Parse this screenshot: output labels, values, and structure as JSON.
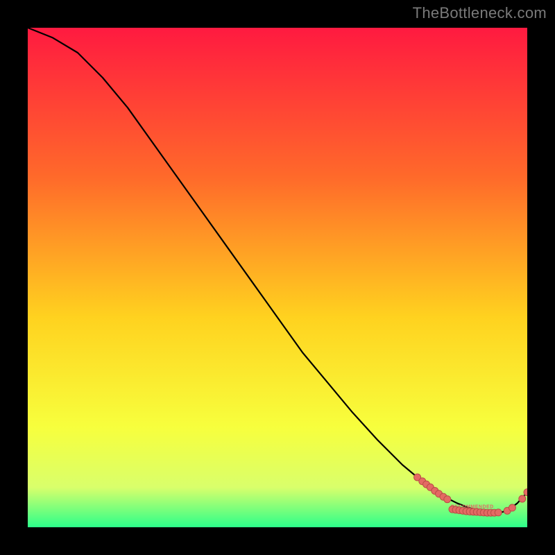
{
  "watermark": "TheBottleneck.com",
  "colors": {
    "page_bg": "#000000",
    "gradient_top": "#ff1a40",
    "gradient_mid_upper": "#ff6a2a",
    "gradient_mid": "#ffd21f",
    "gradient_mid_lower": "#f7ff3d",
    "gradient_near_bottom": "#d9ff6b",
    "gradient_bottom": "#2cff8a",
    "curve": "#000000",
    "marker_fill": "#e46a63",
    "marker_stroke": "#b94d46"
  },
  "chart_data": {
    "type": "line",
    "title": "",
    "xlabel": "",
    "ylabel": "",
    "xlim": [
      0,
      100
    ],
    "ylim": [
      0,
      100
    ],
    "curve": {
      "x": [
        0,
        5,
        10,
        15,
        20,
        25,
        30,
        35,
        40,
        45,
        50,
        55,
        60,
        65,
        70,
        75,
        78,
        80,
        82,
        84,
        86,
        88,
        90,
        92,
        94,
        96,
        98,
        100
      ],
      "y": [
        100,
        98,
        95,
        90,
        84,
        77,
        70,
        63,
        56,
        49,
        42,
        35,
        29,
        23,
        17.5,
        12.5,
        10,
        8.5,
        7,
        5.8,
        4.8,
        4,
        3.4,
        3,
        2.8,
        3.3,
        4.8,
        7
      ]
    },
    "markers": [
      {
        "x": 78.0,
        "y": 10.0
      },
      {
        "x": 79.0,
        "y": 9.2
      },
      {
        "x": 79.8,
        "y": 8.6
      },
      {
        "x": 80.6,
        "y": 8.0
      },
      {
        "x": 81.5,
        "y": 7.3
      },
      {
        "x": 82.3,
        "y": 6.7
      },
      {
        "x": 83.2,
        "y": 6.1
      },
      {
        "x": 84.0,
        "y": 5.6
      },
      {
        "x": 85.0,
        "y": 3.6
      },
      {
        "x": 85.7,
        "y": 3.5
      },
      {
        "x": 86.4,
        "y": 3.4
      },
      {
        "x": 87.1,
        "y": 3.3
      },
      {
        "x": 87.8,
        "y": 3.2
      },
      {
        "x": 88.5,
        "y": 3.15
      },
      {
        "x": 89.2,
        "y": 3.1
      },
      {
        "x": 89.9,
        "y": 3.05
      },
      {
        "x": 90.6,
        "y": 3.0
      },
      {
        "x": 91.3,
        "y": 2.95
      },
      {
        "x": 92.0,
        "y": 2.9
      },
      {
        "x": 92.7,
        "y": 2.9
      },
      {
        "x": 93.4,
        "y": 2.9
      },
      {
        "x": 94.2,
        "y": 2.95
      },
      {
        "x": 96.0,
        "y": 3.3
      },
      {
        "x": 97.0,
        "y": 3.9
      },
      {
        "x": 99.0,
        "y": 5.7
      },
      {
        "x": 100.0,
        "y": 7.0
      }
    ],
    "marker_radius": 5,
    "band_label": {
      "text": "RECOMMENDED",
      "x": 89,
      "y": 3.8
    }
  }
}
